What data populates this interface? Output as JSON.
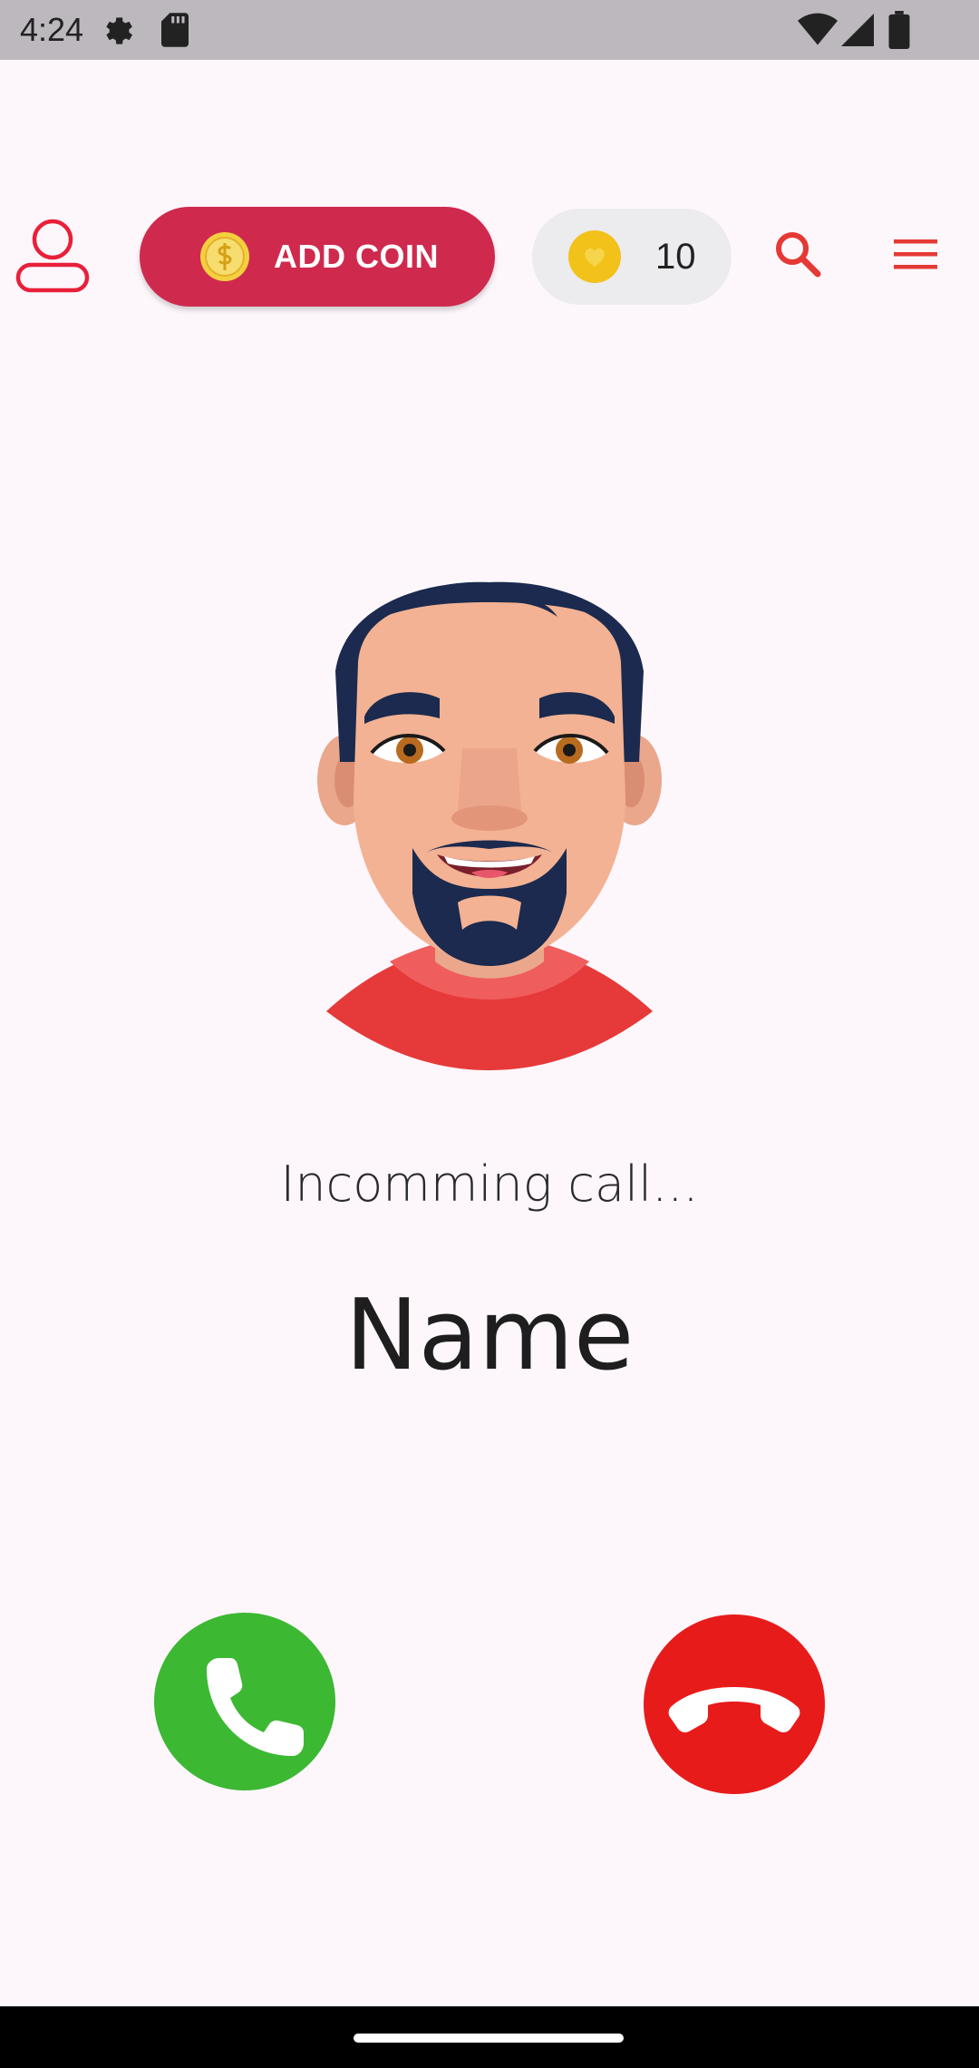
{
  "status_bar": {
    "time": "4:24",
    "icons": [
      "settings-gear-icon",
      "sd-card-icon",
      "wifi-icon",
      "signal-icon",
      "battery-icon"
    ]
  },
  "header": {
    "profile_icon": "user-outline-icon",
    "add_coin_label": "ADD COIN",
    "add_coin_icon": "gold-coin-icon",
    "balance_icon": "heart-coin-icon",
    "balance_value": "10",
    "search_icon": "search-icon",
    "menu_icon": "hamburger-menu-icon"
  },
  "call": {
    "status_text": "Incomming call...",
    "caller_name": "Name",
    "accept_icon": "phone-icon",
    "decline_icon": "hang-up-icon"
  },
  "colors": {
    "background": "#fdf7fc",
    "status_bar": "#bcb8bd",
    "accent_red": "#cf2a4e",
    "icon_red": "#e53935",
    "accept_green": "#3cb832",
    "decline_red": "#e81b1b",
    "coin_yellow": "#f2c21b"
  }
}
